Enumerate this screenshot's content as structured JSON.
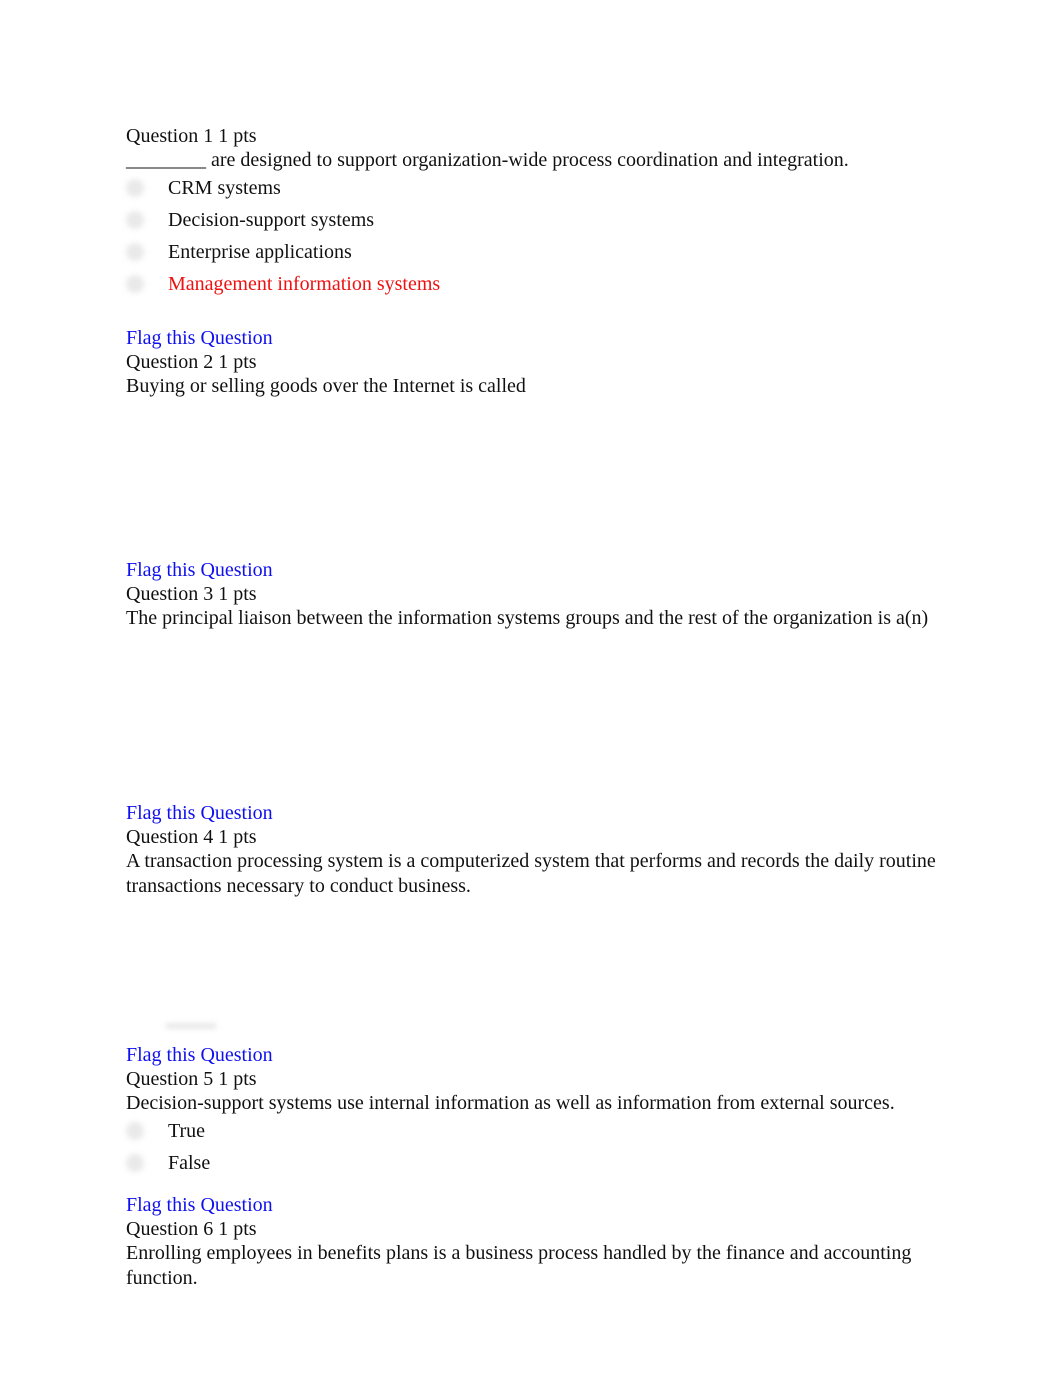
{
  "flag_label": "Flag this Question",
  "questions": [
    {
      "header": "Question 1 1 pts",
      "text": "________ are designed to support organization-wide process coordination and integration.",
      "options": [
        {
          "label": "CRM systems",
          "state": "default"
        },
        {
          "label": "Decision-support systems",
          "state": "default"
        },
        {
          "label": "Enterprise applications",
          "state": "default"
        },
        {
          "label": "Management information systems",
          "state": "incorrect"
        }
      ]
    },
    {
      "header": "Question 2 1 pts",
      "text": "Buying or selling goods over the Internet is called"
    },
    {
      "header": "Question 3 1 pts",
      "text": "The principal liaison between the information systems groups and the rest of the organization is a(n)"
    },
    {
      "header": "Question 4 1 pts",
      "text": "A transaction processing system is a computerized system that performs and records the daily routine transactions necessary to conduct business."
    },
    {
      "header": "Question 5 1 pts",
      "text": "Decision-support systems use internal information as well as information from external sources.",
      "options": [
        {
          "label": "True",
          "state": "default"
        },
        {
          "label": "False",
          "state": "default"
        }
      ]
    },
    {
      "header": "Question 6 1 pts",
      "text": "Enrolling employees in benefits plans is a business process handled by the finance and accounting function."
    }
  ],
  "colors": {
    "link": "#1010ee",
    "incorrect": "#ee1111",
    "text": "#111111"
  }
}
